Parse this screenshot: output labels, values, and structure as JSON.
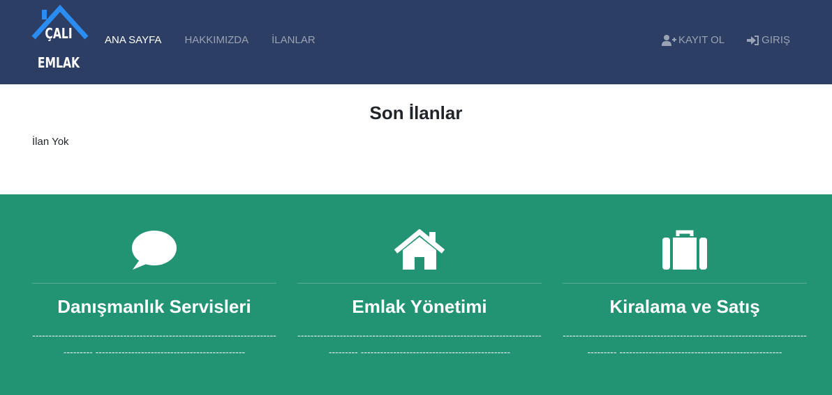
{
  "brand": {
    "line1": "ÇALI",
    "line2": "EMLAK",
    "accent": "#2b8cf2"
  },
  "nav": {
    "items": [
      {
        "label": "ANA SAYFA",
        "active": true
      },
      {
        "label": "HAKKIMIZDA",
        "active": false
      },
      {
        "label": "İLANLAR",
        "active": false
      }
    ],
    "register": {
      "label": "KAYIT OL",
      "icon": "user-plus-icon"
    },
    "login": {
      "label": "GIRIŞ",
      "icon": "sign-in-icon"
    }
  },
  "latest": {
    "title": "Son İlanlar",
    "empty_text": "İlan Yok"
  },
  "services": [
    {
      "icon": "comment-icon",
      "title": "Danışmanlık Servisleri",
      "text": "------------------------------------------------------------------------------------ ----------------------------------------------"
    },
    {
      "icon": "home-icon",
      "title": "Emlak Yönetimi",
      "text": "------------------------------------------------------------------------------------ ----------------------------------------------"
    },
    {
      "icon": "suitcase-icon",
      "title": "Kiralama ve Satış",
      "text": "------------------------------------------------------------------------------------ --------------------------------------------------"
    }
  ],
  "colors": {
    "navbar": "#2c3e63",
    "services_bg": "#229373"
  }
}
